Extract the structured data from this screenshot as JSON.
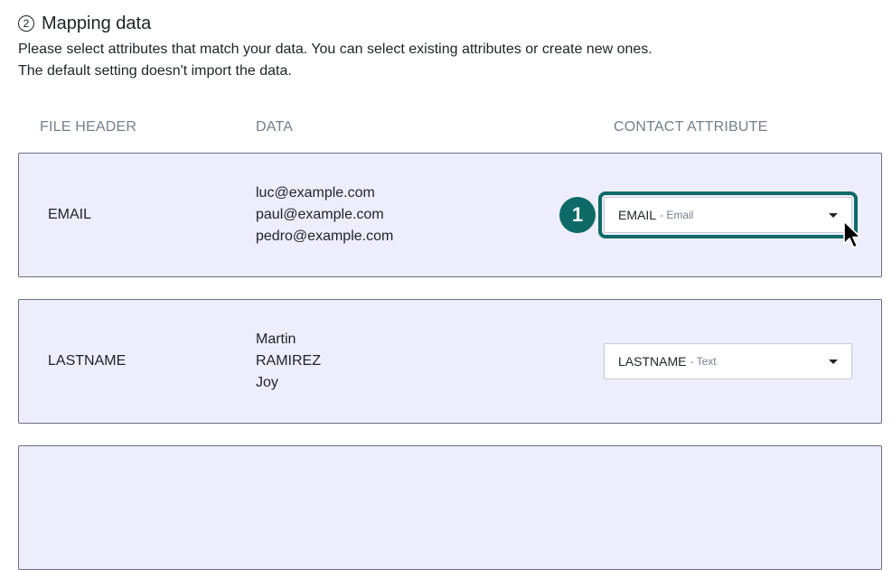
{
  "section": {
    "step_number": "2",
    "title": "Mapping data",
    "description_lines": [
      "Please select attributes that match your data. You can select existing attributes or create new ones.",
      "The default setting doesn't import the data."
    ]
  },
  "columns": {
    "file_header": "FILE HEADER",
    "data": "DATA",
    "contact_attribute": "CONTACT ATTRIBUTE"
  },
  "rows": [
    {
      "header": "EMAIL",
      "data": [
        "luc@example.com",
        "paul@example.com",
        "pedro@example.com"
      ],
      "attribute": {
        "name": "EMAIL",
        "type": "- Email"
      }
    },
    {
      "header": "LASTNAME",
      "data": [
        "Martin",
        "RAMIREZ",
        "Joy"
      ],
      "attribute": {
        "name": "LASTNAME",
        "type": "- Text"
      }
    }
  ],
  "callout": {
    "number": "1"
  },
  "icons": {
    "step": "step-number-icon",
    "caret": "caret-down-icon",
    "cursor": "mouse-pointer-icon"
  },
  "colors": {
    "accent": "#0e6a67",
    "row_background": "#ededfb",
    "row_border": "#6e6e8a",
    "muted_text": "#737f8c"
  }
}
